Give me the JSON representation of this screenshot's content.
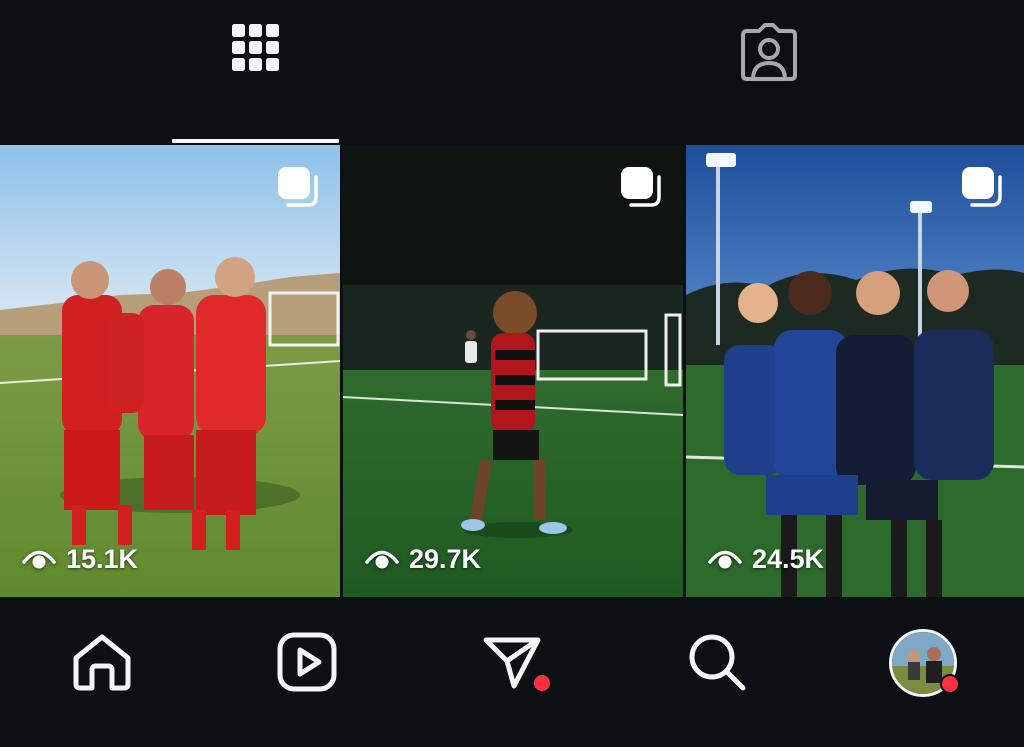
{
  "tabs": [
    {
      "name": "grid",
      "icon": "grid-icon",
      "selected": true
    },
    {
      "name": "tagged",
      "icon": "tagged-person-icon",
      "selected": false
    }
  ],
  "posts": [
    {
      "views": "15.1K",
      "icon": "carousel-icon",
      "view_icon": "eye-icon"
    },
    {
      "views": "29.7K",
      "icon": "carousel-icon",
      "view_icon": "eye-icon"
    },
    {
      "views": "24.5K",
      "icon": "carousel-icon",
      "view_icon": "eye-icon"
    }
  ],
  "bottom_nav": [
    {
      "name": "home",
      "icon": "home-icon"
    },
    {
      "name": "reels",
      "icon": "reels-icon"
    },
    {
      "name": "direct",
      "icon": "direct-send-icon",
      "notification_dot": true
    },
    {
      "name": "search",
      "icon": "search-icon"
    },
    {
      "name": "profile",
      "icon": "avatar",
      "notification_dot": true
    }
  ],
  "colors": {
    "background": "#0c1014",
    "icon": "#f5f5f5",
    "notification": "#ff3040"
  }
}
